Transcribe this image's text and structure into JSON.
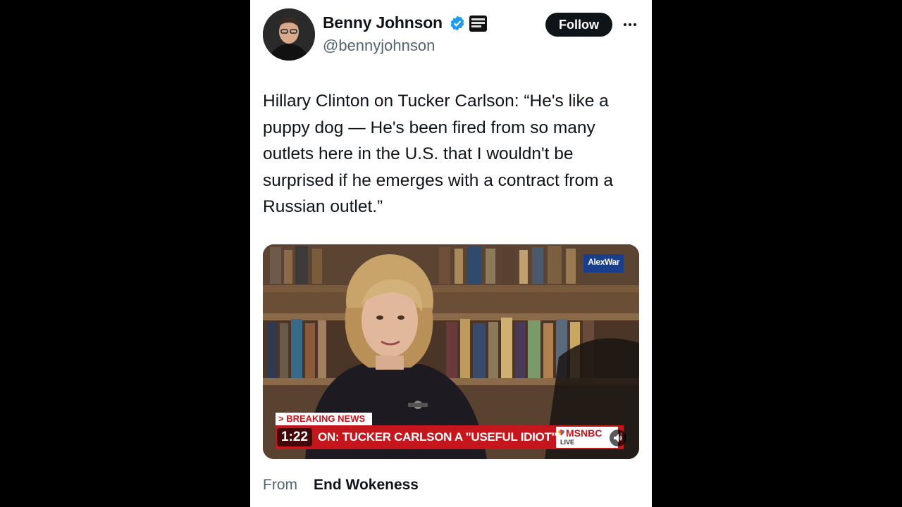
{
  "author": {
    "display_name": "Benny Johnson",
    "handle": "@bennyjohnson",
    "verified": true
  },
  "follow_label": "Follow",
  "tweet": {
    "text": "Hillary Clinton on Tucker Carlson: “He's like a puppy dog — He's been fired from so many outlets here in the U.S. that I wouldn't be surprised if he emerges with a contract from a Russian outlet.”"
  },
  "video": {
    "watermark": "AlexWar",
    "breaking_label": "> BREAKING NEWS",
    "chyron": "ON: TUCKER CARLSON A \"USEFUL IDIOT\" FOR PUTIN",
    "network": "MSNBC",
    "live_label": "LIVE",
    "timestamp": "1:22"
  },
  "attribution": {
    "from_label": "From",
    "source": "End Wokeness"
  },
  "colors": {
    "verified": "#1d9bf0",
    "chyron_red": "#c4161c",
    "follow_bg": "#0f1419",
    "background": "#000000"
  },
  "icons": [
    "verified-badge-icon",
    "affiliation-badge-icon",
    "more-options-icon",
    "speaker-icon",
    "peacock-icon"
  ]
}
